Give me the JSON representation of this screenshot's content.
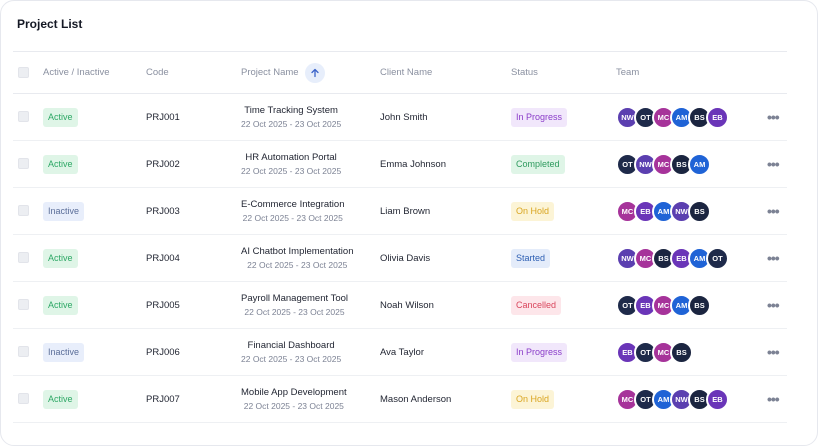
{
  "page": {
    "title": "Project List"
  },
  "table": {
    "headers": {
      "active": "Active / Inactive",
      "code": "Code",
      "project_name": "Project Name",
      "client_name": "Client Name",
      "status": "Status",
      "team": "Team"
    },
    "sort_icon": "arrow-up-icon",
    "rows": [
      {
        "active": "Active",
        "code": "PRJ001",
        "name": "Time Tracking System",
        "dates": "22 Oct 2025 - 23 Oct 2025",
        "client": "John Smith",
        "status": "In Progress",
        "status_kind": "progress",
        "team": [
          "NW",
          "OT",
          "MC",
          "AM",
          "BS",
          "EB"
        ]
      },
      {
        "active": "Active",
        "code": "PRJ002",
        "name": "HR Automation Portal",
        "dates": "22 Oct 2025 - 23 Oct 2025",
        "client": "Emma Johnson",
        "status": "Completed",
        "status_kind": "completed",
        "team": [
          "OT",
          "NW",
          "MC",
          "BS",
          "AM"
        ]
      },
      {
        "active": "Inactive",
        "code": "PRJ003",
        "name": "E-Commerce Integration",
        "dates": "22 Oct 2025 - 23 Oct 2025",
        "client": "Liam Brown",
        "status": "On Hold",
        "status_kind": "hold",
        "team": [
          "MC",
          "EB",
          "AM",
          "NW",
          "BS"
        ]
      },
      {
        "active": "Active",
        "code": "PRJ004",
        "name": "AI Chatbot Implementation",
        "dates": "22 Oct 2025 - 23 Oct 2025",
        "client": "Olivia Davis",
        "status": "Started",
        "status_kind": "started",
        "team": [
          "NW",
          "MC",
          "BS",
          "EB",
          "AM",
          "OT"
        ]
      },
      {
        "active": "Active",
        "code": "PRJ005",
        "name": "Payroll Management Tool",
        "dates": "22 Oct 2025 - 23 Oct 2025",
        "client": "Noah Wilson",
        "status": "Cancelled",
        "status_kind": "cancelled",
        "team": [
          "OT",
          "EB",
          "MC",
          "AM",
          "BS"
        ]
      },
      {
        "active": "Inactive",
        "code": "PRJ006",
        "name": "Financial Dashboard",
        "dates": "22 Oct 2025 - 23 Oct 2025",
        "client": "Ava Taylor",
        "status": "In Progress",
        "status_kind": "progress",
        "team": [
          "EB",
          "OT",
          "MC",
          "BS"
        ]
      },
      {
        "active": "Active",
        "code": "PRJ007",
        "name": "Mobile App Development",
        "dates": "22 Oct 2025 - 23 Oct 2025",
        "client": "Mason Anderson",
        "status": "On Hold",
        "status_kind": "hold",
        "team": [
          "MC",
          "OT",
          "AM",
          "NW",
          "BS",
          "EB"
        ]
      }
    ],
    "row_action_icon": "more-horizontal-icon"
  },
  "avatar_colors": {
    "NW": "#5b3fb0",
    "OT": "#1e2a4a",
    "MC": "#a6339a",
    "AM": "#1f63d6",
    "BS": "#1b2540",
    "EB": "#6a35b8"
  }
}
